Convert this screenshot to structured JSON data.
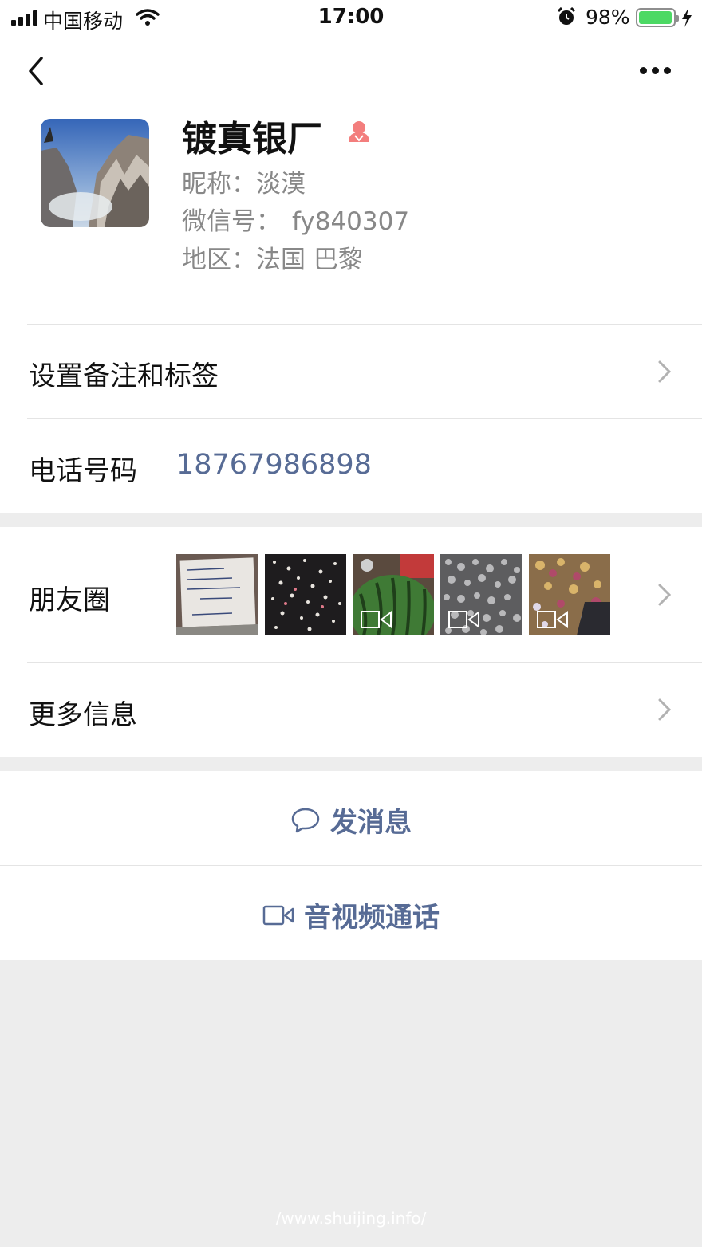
{
  "status_bar": {
    "carrier": "中国移动",
    "time": "17:00",
    "battery": "98%",
    "battery_level": 0.98,
    "icons": [
      "signal-icon",
      "wifi-icon",
      "alarm-icon",
      "battery-icon",
      "charging-icon"
    ]
  },
  "nav": {
    "back_icon": "chevron-left-icon",
    "more_icon": "more-dots-icon"
  },
  "profile": {
    "name": "镀真银厂",
    "gender_icon": "female-icon",
    "nickname_label": "昵称：",
    "nickname": "淡漠",
    "wechat_id_label": "微信号：",
    "wechat_id": "fy840307",
    "region_label": "地区：",
    "region": "法国 巴黎"
  },
  "rows": {
    "remark_label": "设置备注和标签",
    "phone_label": "电话号码",
    "phone_value": "18767986898",
    "moments_label": "朋友圈",
    "more_info_label": "更多信息"
  },
  "moments_thumbs": [
    {
      "name": "handwritten-note",
      "video": false
    },
    {
      "name": "scattered-pieces",
      "video": false
    },
    {
      "name": "watermelon",
      "video": true
    },
    {
      "name": "silver-granules",
      "video": true
    },
    {
      "name": "colorful-pieces",
      "video": true
    }
  ],
  "actions": {
    "message_label": "发消息",
    "message_icon": "chat-bubble-icon",
    "call_label": "音视频通话",
    "call_icon": "video-camera-icon"
  },
  "colors": {
    "link": "#576b95",
    "background": "#ededed",
    "battery": "#4cd964",
    "gender": "#f37e7d"
  },
  "watermark": "/www.shuijing.info/"
}
